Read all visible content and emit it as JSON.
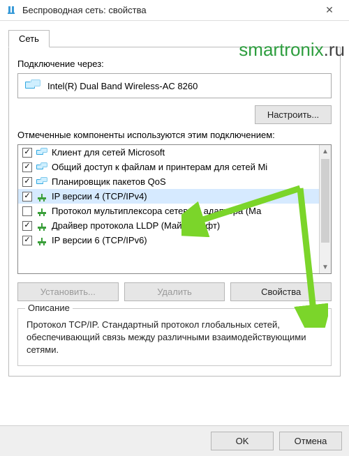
{
  "window": {
    "title": "Беспроводная сеть: свойства",
    "watermark_main": "smartronix",
    "watermark_suffix": ".ru"
  },
  "tab": {
    "network": "Сеть"
  },
  "labels": {
    "connect_using": "Подключение через:",
    "components": "Отмеченные компоненты используются этим подключением:"
  },
  "adapter": {
    "name": "Intel(R) Dual Band Wireless-AC 8260"
  },
  "buttons": {
    "configure": "Настроить...",
    "install": "Установить...",
    "remove": "Удалить",
    "properties": "Свойства",
    "ok": "OK",
    "cancel": "Отмена"
  },
  "items": [
    {
      "checked": true,
      "icon": "monitors",
      "label": "Клиент для сетей Microsoft"
    },
    {
      "checked": true,
      "icon": "monitors",
      "label": "Общий доступ к файлам и принтерам для сетей Mi"
    },
    {
      "checked": true,
      "icon": "monitors",
      "label": "Планировщик пакетов QoS"
    },
    {
      "checked": true,
      "icon": "net",
      "label": "IP версии 4 (TCP/IPv4)",
      "selected": true
    },
    {
      "checked": false,
      "icon": "net",
      "label": "Протокол мультиплексора сетевого адаптера (Ма"
    },
    {
      "checked": true,
      "icon": "net",
      "label": "Драйвер протокола LLDP (Майкрософт)"
    },
    {
      "checked": true,
      "icon": "net",
      "label": "IP версии 6 (TCP/IPv6)"
    }
  ],
  "description": {
    "title": "Описание",
    "text": "Протокол TCP/IP. Стандартный протокол глобальных сетей, обеспечивающий связь между различными взаимодействующими сетями."
  }
}
